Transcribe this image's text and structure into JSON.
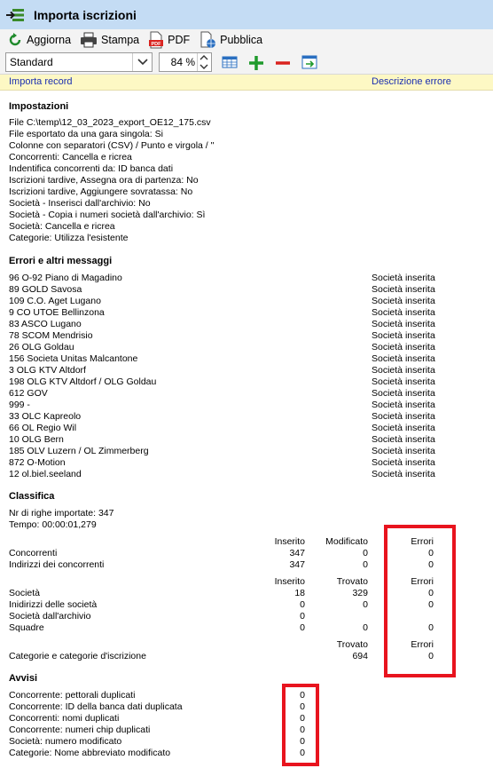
{
  "window": {
    "title": "Importa iscrizioni"
  },
  "toolbar": {
    "refresh": "Aggiorna",
    "print": "Stampa",
    "pdf": "PDF",
    "publish": "Pubblica",
    "pdf_badge": "PDF"
  },
  "view": {
    "selected": "Standard",
    "zoom": "84 %"
  },
  "header": {
    "col1": "Importa record",
    "col2": "Descrizione errore"
  },
  "settings": {
    "title": "Impostazioni",
    "lines": [
      "File C:\\temp\\12_03_2023_export_OE12_175.csv",
      "File esportato da una gara singola: Si",
      "Colonne con separatori (CSV) / Punto e virgola / \"",
      "Concorrenti: Cancella e ricrea",
      "Indentifica concorrenti da: ID banca dati",
      "Iscrizioni tardive, Assegna ora di partenza: No",
      "Iscrizioni tardive, Aggiungere sovratassa: No",
      "Società - Inserisci dall'archivio: No",
      "Società - Copia i numeri società dall'archivio: Sì",
      "Società: Cancella e ricrea",
      "Categorie: Utilizza l'esistente"
    ]
  },
  "errors": {
    "title": "Errori e altri messaggi",
    "rows": [
      {
        "record": "96 O-92 Piano di Magadino",
        "desc": "Società inserita"
      },
      {
        "record": "89 GOLD Savosa",
        "desc": "Società inserita"
      },
      {
        "record": "109 C.O. Aget Lugano",
        "desc": "Società inserita"
      },
      {
        "record": "9 CO UTOE Bellinzona",
        "desc": "Società inserita"
      },
      {
        "record": "83 ASCO Lugano",
        "desc": "Società inserita"
      },
      {
        "record": "78 SCOM Mendrisio",
        "desc": "Società inserita"
      },
      {
        "record": "26 OLG Goldau",
        "desc": "Società inserita"
      },
      {
        "record": "156 Societa Unitas Malcantone",
        "desc": "Società inserita"
      },
      {
        "record": "3 OLG KTV Altdorf",
        "desc": "Società inserita"
      },
      {
        "record": "198 OLG KTV Altdorf / OLG Goldau",
        "desc": "Società inserita"
      },
      {
        "record": "612 GOV",
        "desc": "Società inserita"
      },
      {
        "record": "999 -",
        "desc": "Società inserita"
      },
      {
        "record": "33 OLC Kapreolo",
        "desc": "Società inserita"
      },
      {
        "record": "66 OL Regio Wil",
        "desc": "Società inserita"
      },
      {
        "record": "10 OLG Bern",
        "desc": "Società inserita"
      },
      {
        "record": "185 OLV Luzern / OL Zimmerberg",
        "desc": "Società inserita"
      },
      {
        "record": "872 O-Motion",
        "desc": "Società inserita"
      },
      {
        "record": "12 ol.biel.seeland",
        "desc": "Società inserita"
      }
    ]
  },
  "summary": {
    "title": "Classifica",
    "rows_imported": "Nr di righe importate: 347",
    "time": "Tempo: 00:00:01,279",
    "block1": {
      "h_inserted": "Inserito",
      "h_modified": "Modificato",
      "h_errors": "Errori",
      "rows": [
        {
          "label": "Concorrenti",
          "a": "347",
          "b": "0",
          "c": "0"
        },
        {
          "label": "Indirizzi dei concorrenti",
          "a": "347",
          "b": "0",
          "c": "0"
        }
      ]
    },
    "block2": {
      "h_inserted": "Inserito",
      "h_found": "Trovato",
      "h_errors": "Errori",
      "rows": [
        {
          "label": "Società",
          "a": "18",
          "b": "329",
          "c": "0"
        },
        {
          "label": "Inidirizzi delle società",
          "a": "0",
          "b": "0",
          "c": "0"
        },
        {
          "label": "Società dall'archivio",
          "a": "0",
          "b": "",
          "c": ""
        },
        {
          "label": "Squadre",
          "a": "0",
          "b": "0",
          "c": "0"
        }
      ]
    },
    "block3": {
      "h_found": "Trovato",
      "h_errors": "Errori",
      "row": {
        "label": "Categorie e categorie d'iscrizione",
        "b": "694",
        "c": "0"
      }
    }
  },
  "warnings": {
    "title": "Avvisi",
    "rows": [
      {
        "label": "Concorrente: pettorali duplicati",
        "value": "0"
      },
      {
        "label": "Concorrente: ID della banca dati duplicata",
        "value": "0"
      },
      {
        "label": "Concorrenti: nomi duplicati",
        "value": "0"
      },
      {
        "label": "Concorrente: numeri chip duplicati",
        "value": "0"
      },
      {
        "label": "Società: numero modificato",
        "value": "0"
      },
      {
        "label": "Categorie: Nome abbreviato modificato",
        "value": "0"
      }
    ]
  },
  "colors": {
    "titlebar": "#c4dcf4",
    "header": "#fdf8c4",
    "highlight": "#e8141e",
    "link": "#1b2fb0"
  }
}
